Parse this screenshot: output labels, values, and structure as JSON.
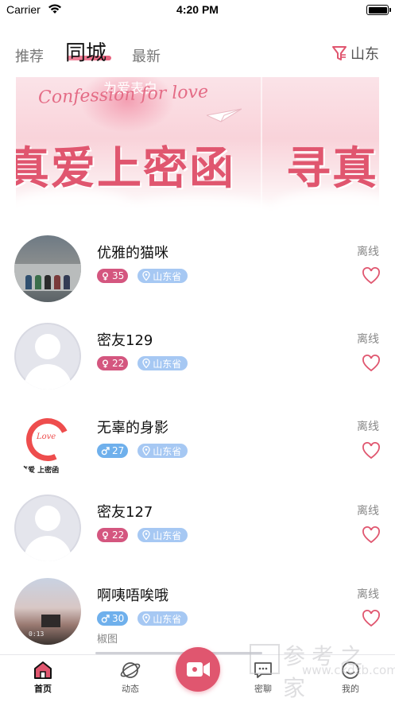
{
  "status_bar": {
    "carrier": "Carrier",
    "time": "4:20 PM"
  },
  "tabs": [
    {
      "label": "推荐"
    },
    {
      "label": "同城"
    },
    {
      "label": "最新"
    }
  ],
  "filter": {
    "label": "山东"
  },
  "banner": {
    "script_text": "Confession for love",
    "top_text": "为爱表白",
    "big_left": "真爱上密函",
    "big_right": "寻真"
  },
  "users": [
    {
      "name": "优雅的猫咪",
      "gender": "female",
      "age": "35",
      "location": "山东省",
      "status": "离线",
      "avatar": "group-photo"
    },
    {
      "name": "密友129",
      "gender": "female",
      "age": "22",
      "location": "山东省",
      "status": "离线",
      "avatar": "default"
    },
    {
      "name": "无辜的身影",
      "gender": "male",
      "age": "27",
      "location": "山东省",
      "status": "离线",
      "avatar": "love-logo",
      "avatar_caption": "真爱 上密函",
      "avatar_logo_text": "Love"
    },
    {
      "name": "密友127",
      "gender": "female",
      "age": "22",
      "location": "山东省",
      "status": "离线",
      "avatar": "default"
    },
    {
      "name": "啊咦唔唉哦",
      "gender": "male",
      "age": "30",
      "location": "山东省",
      "status": "离线",
      "avatar": "sky-photo",
      "avatar_stamp": "0:13"
    }
  ],
  "caption_below": "椒图",
  "tabbar": {
    "home": "首页",
    "dynamic": "动态",
    "chat": "密聊",
    "me": "我的"
  },
  "watermark": {
    "text": "参考之家",
    "url": "www.ckdzb.com"
  },
  "colors": {
    "accent": "#e0566f",
    "female_badge": "#d4567f",
    "male_badge": "#6fb0ec",
    "location_badge": "#a6c8f3"
  },
  "icons": {
    "filter": "filter-icon",
    "home": "home-icon",
    "dynamic": "planet-icon",
    "center": "video-camera-icon",
    "chat": "chat-icon",
    "me": "smile-icon",
    "like": "heart-icon",
    "location": "location-pin-icon",
    "female": "female-icon",
    "male": "male-icon"
  }
}
